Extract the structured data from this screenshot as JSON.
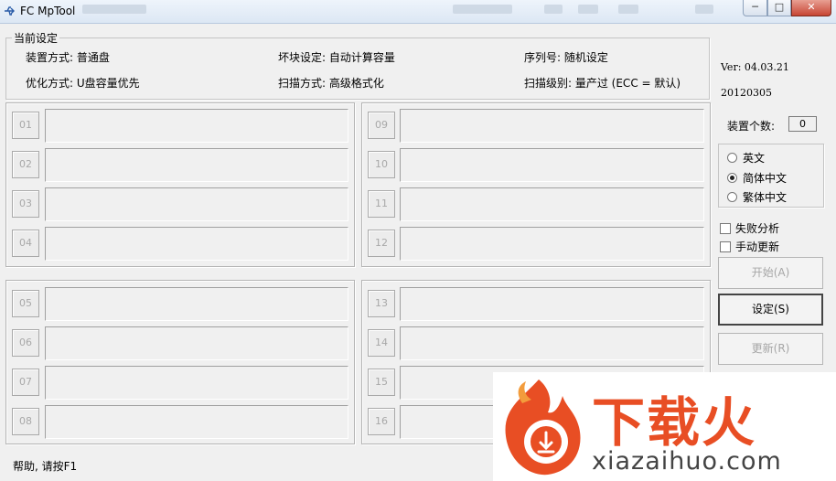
{
  "window": {
    "title": "FC MpTool",
    "min_glyph": "─",
    "max_glyph": "□",
    "close_glyph": "✕"
  },
  "settings": {
    "legend": "当前设定",
    "device_mode": "装置方式: 普通盘",
    "bad_block": "坏块设定: 自动计算容量",
    "serial": "序列号: 随机设定",
    "optimize": "优化方式: U盘容量优先",
    "scan_mode": "扫描方式: 高级格式化",
    "scan_level": "扫描级别: 量产过 (ECC = 默认)"
  },
  "ports": {
    "group1": [
      "01",
      "02",
      "03",
      "04"
    ],
    "group2": [
      "09",
      "10",
      "11",
      "12"
    ],
    "group3": [
      "05",
      "06",
      "07",
      "08"
    ],
    "group4": [
      "13",
      "14",
      "15",
      "16"
    ]
  },
  "sidebar": {
    "version": "Ver: 04.03.21",
    "date": "20120305",
    "device_count_label": "装置个数:",
    "device_count": "0",
    "languages": [
      {
        "label": "英文",
        "selected": false
      },
      {
        "label": "简体中文",
        "selected": true
      },
      {
        "label": "繁体中文",
        "selected": false
      }
    ],
    "fail_analysis": "失败分析",
    "manual_update": "手动更新",
    "start_button": "开始(A)",
    "settings_button": "设定(S)",
    "update_button": "更新(R)"
  },
  "status_bar": {
    "help": "帮助, 请按F1"
  },
  "watermark": {
    "cn": "下载火",
    "en": "xiazaihuo.com",
    "brand_color": "#e84e24"
  }
}
